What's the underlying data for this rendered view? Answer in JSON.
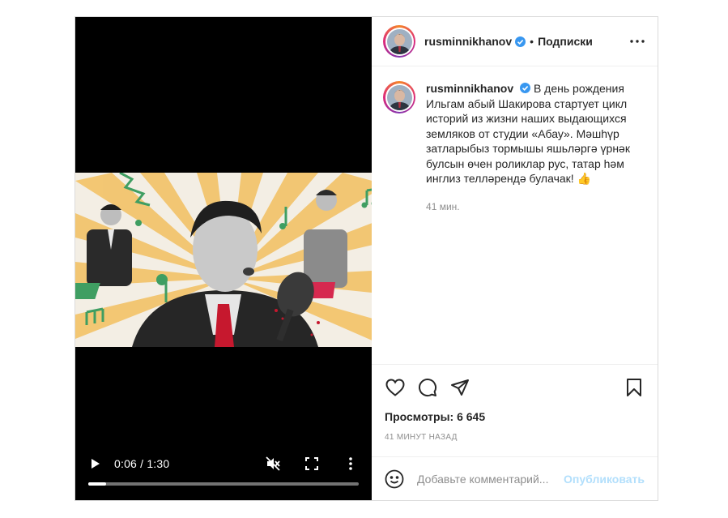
{
  "post": {
    "username": "rusminnikhanov",
    "separator": "•",
    "follow_label": "Подписки",
    "caption_text": "В день рождения Ильгам абый Шакирова стартует цикл историй из жизни наших выдающихся земляков от студии «Абау». Мәшһүр затларыбыз тормышы яшьләргә үрнәк булсын өчен роликлар рус, татар һәм инглиз телләрендә булачак! 👍",
    "caption_time": "41 мин.",
    "views": "Просмотры: 6 645",
    "posted_ago": "41 МИНУТ НАЗАД",
    "comment_placeholder": "Добавьте комментарий...",
    "publish_label": "Опубликовать"
  },
  "video": {
    "time_display": "0:06 / 1:30",
    "progress_fraction": 0.0667
  },
  "icons": {
    "header": [
      "verified-icon",
      "more-icon"
    ],
    "actions": [
      "heart-icon",
      "comment-icon",
      "share-icon",
      "bookmark-icon"
    ],
    "controls": [
      "play-icon",
      "mute-icon",
      "fullscreen-icon",
      "options-icon"
    ],
    "composer": [
      "emoji-icon"
    ]
  },
  "colors": {
    "verified": "#3897f0",
    "publish_disabled": "#b2dffc",
    "secondary_text": "#8e8e8e",
    "border": "#dbdbdb"
  }
}
